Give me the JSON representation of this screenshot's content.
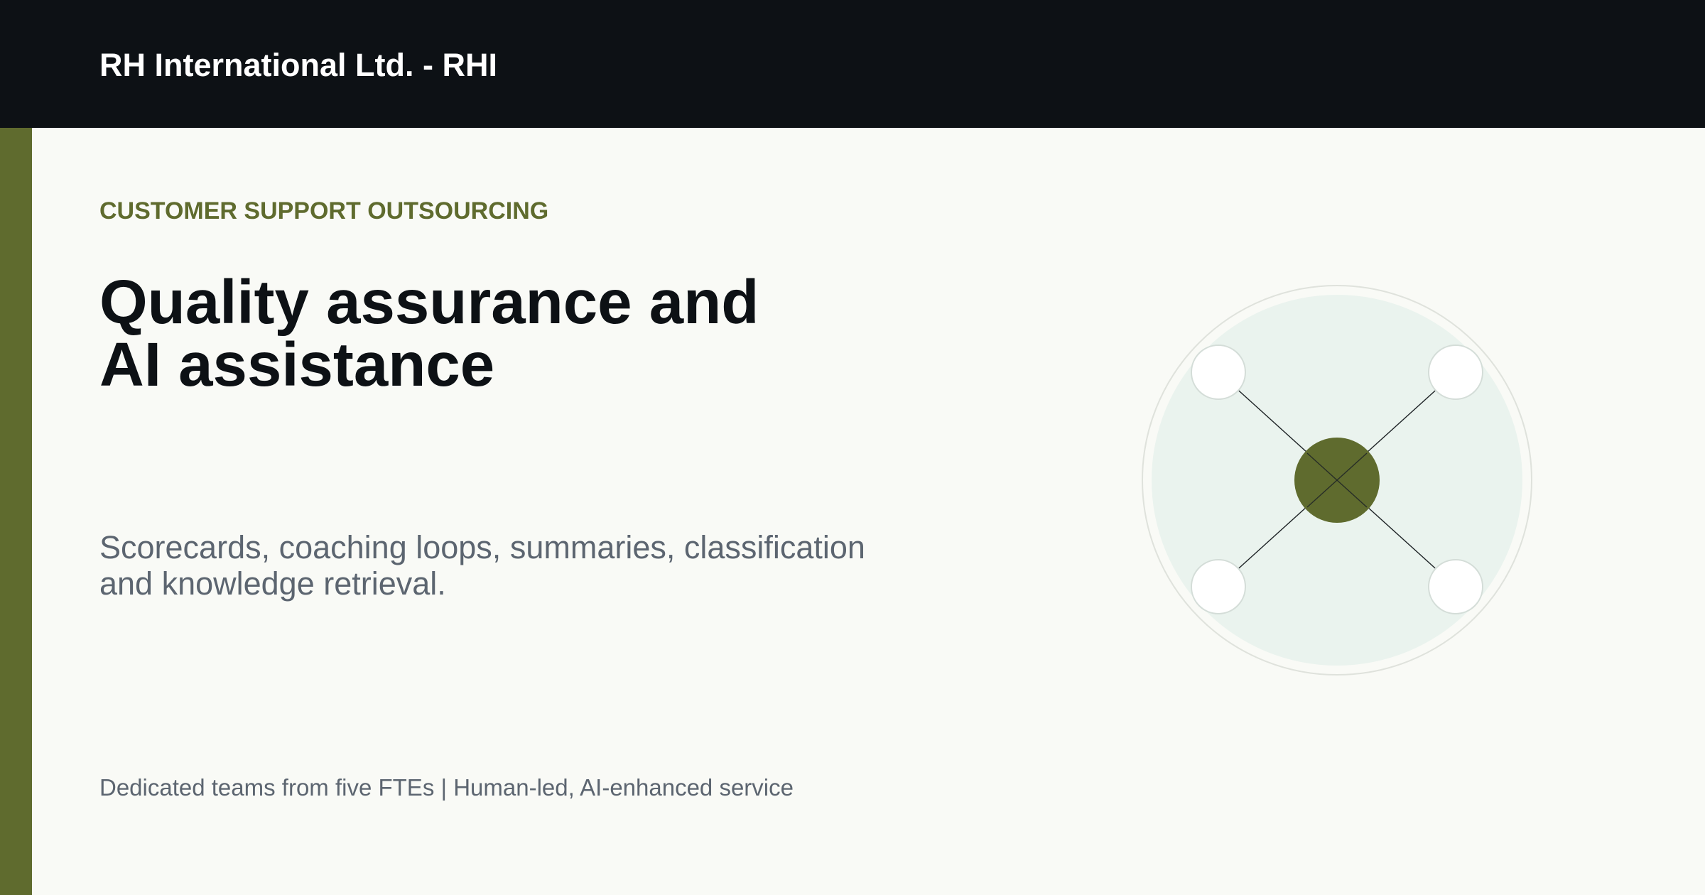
{
  "header": {
    "brand": "RH International Ltd. - RHI"
  },
  "hero": {
    "eyebrow": "CUSTOMER SUPPORT OUTSOURCING",
    "headline_lines": [
      "Quality assurance and",
      "AI assistance"
    ],
    "subtitle_lines": [
      "Scorecards, coaching loops, summaries, classification",
      "and knowledge retrieval."
    ],
    "footer_note": "Dedicated teams from five FTEs | Human-led, AI-enhanced service"
  },
  "colors": {
    "header_bg": "#0d1115",
    "accent": "#5f6b2e",
    "page_bg": "#f9faf6",
    "diagram_fill": "#eaf3ee",
    "muted_text": "#5c6570"
  },
  "illustration": {
    "name": "hub-network-illustration",
    "satellite_count": 4
  }
}
